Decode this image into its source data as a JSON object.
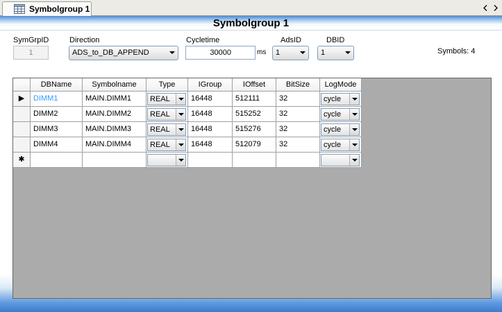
{
  "tab": {
    "label": "Symbolgroup 1"
  },
  "title": "Symbolgroup 1",
  "form": {
    "symgrpid_label": "SymGrpID",
    "symgrpid_value": "1",
    "direction_label": "Direction",
    "direction_value": "ADS_to_DB_APPEND",
    "cycletime_label": "Cycletime",
    "cycletime_value": "30000",
    "cycletime_unit": "ms",
    "adsid_label": "AdsID",
    "adsid_value": "1",
    "dbid_label": "DBID",
    "dbid_value": "1",
    "symbols_text": "Symbols: 4"
  },
  "grid": {
    "columns": [
      "DBName",
      "Symbolname",
      "Type",
      "IGroup",
      "IOffset",
      "BitSize",
      "LogMode"
    ],
    "rows": [
      {
        "DBName": "DIMM1",
        "Symbolname": "MAIN.DIMM1",
        "Type": "REAL",
        "IGroup": "16448",
        "IOffset": "512111",
        "BitSize": "32",
        "LogMode": "cycle"
      },
      {
        "DBName": "DIMM2",
        "Symbolname": "MAIN.DIMM2",
        "Type": "REAL",
        "IGroup": "16448",
        "IOffset": "515252",
        "BitSize": "32",
        "LogMode": "cycle"
      },
      {
        "DBName": "DIMM3",
        "Symbolname": "MAIN.DIMM3",
        "Type": "REAL",
        "IGroup": "16448",
        "IOffset": "515276",
        "BitSize": "32",
        "LogMode": "cycle"
      },
      {
        "DBName": "DIMM4",
        "Symbolname": "MAIN.DIMM4",
        "Type": "REAL",
        "IGroup": "16448",
        "IOffset": "512079",
        "BitSize": "32",
        "LogMode": "cycle"
      }
    ],
    "current_row_marker": "▶",
    "new_row_marker": "✱"
  },
  "icons": {
    "tab": "grid-table-icon",
    "nav_left": "nav-left-icon",
    "nav_right": "nav-right-icon"
  },
  "colors": {
    "selected_text": "#3399ff",
    "grid_background": "#ababab",
    "title_gradient_top": "#4c8bd6"
  }
}
